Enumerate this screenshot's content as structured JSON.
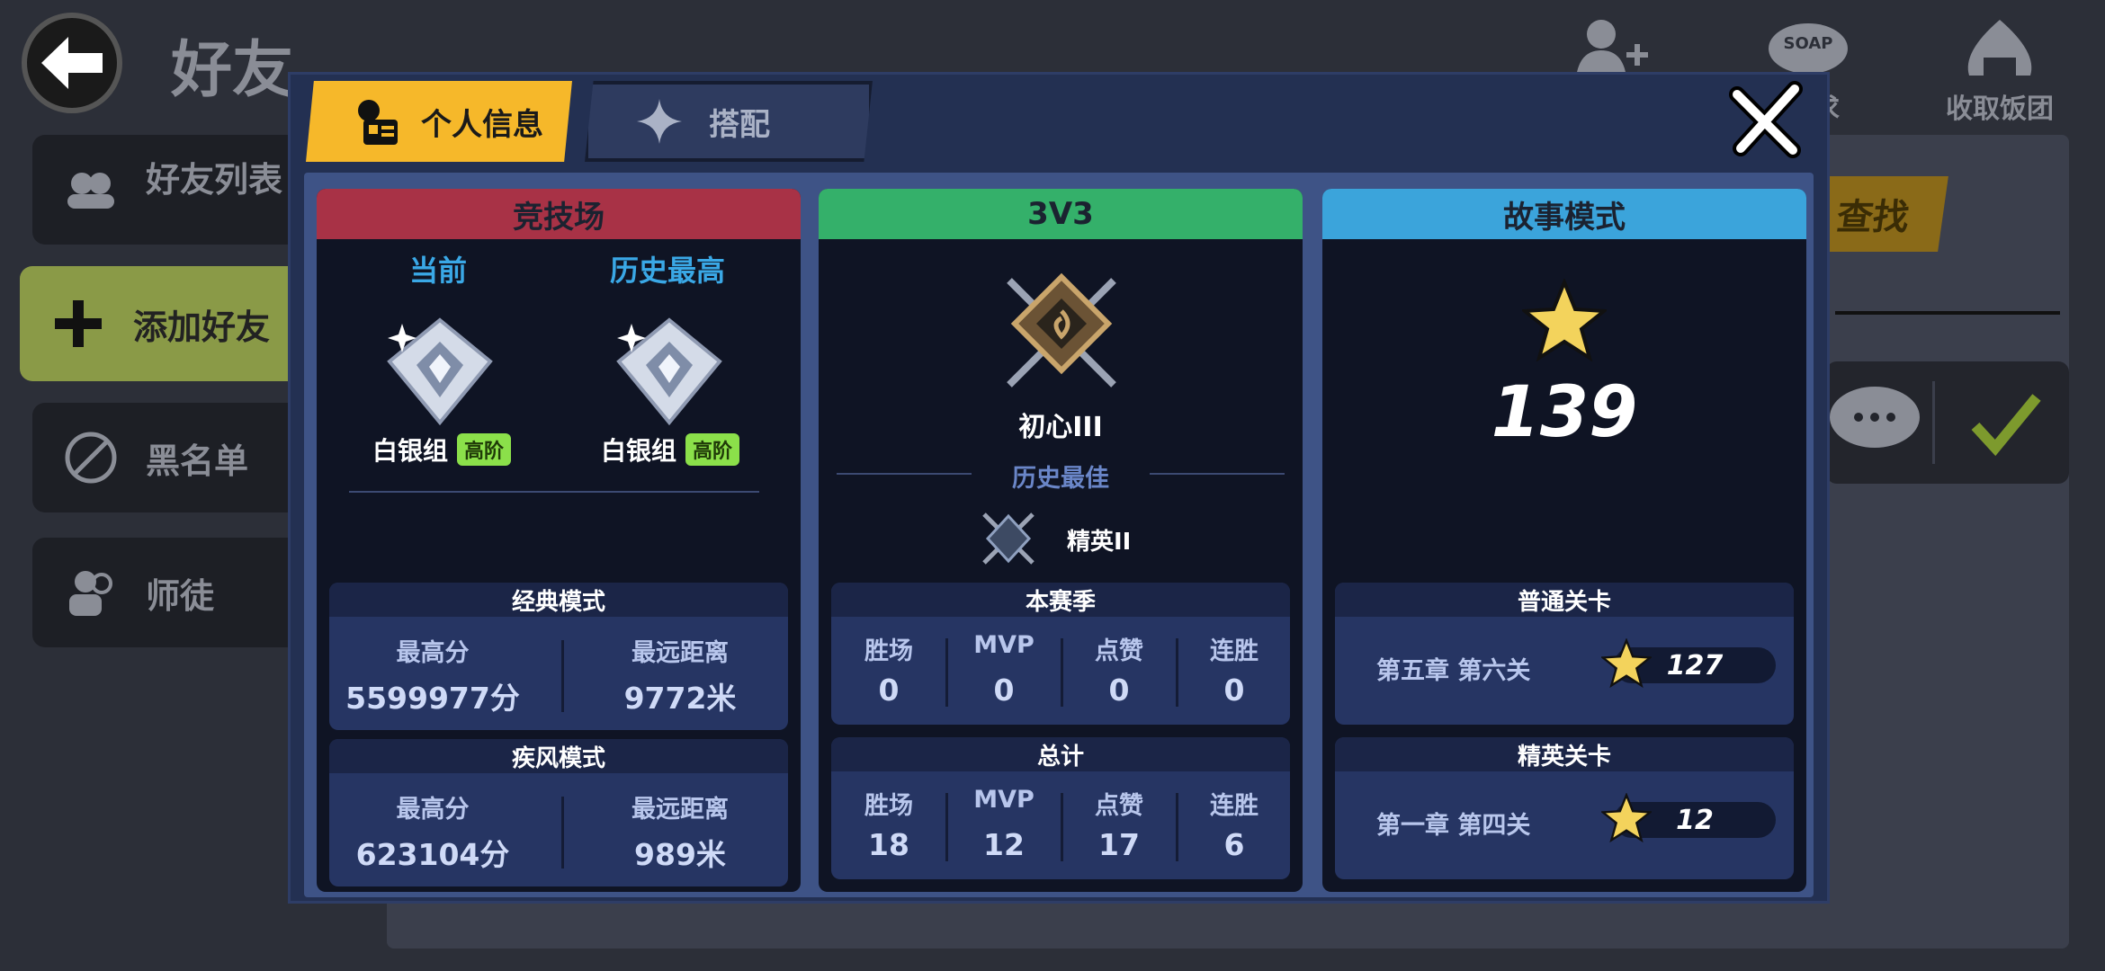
{
  "background": {
    "title": "好友",
    "top_actions": [
      {
        "label": "",
        "icon": "add-friend-icon"
      },
      {
        "label": "求",
        "icon": "soap-icon"
      },
      {
        "label": "收取饭团",
        "icon": "rice-ball-icon"
      }
    ],
    "sidebar": [
      {
        "label": "好友列表",
        "icon": "friends-icon"
      },
      {
        "label": "添加好友",
        "icon": "plus-icon"
      },
      {
        "label": "黑名单",
        "icon": "block-icon"
      },
      {
        "label": "师徒",
        "icon": "mentor-icon"
      }
    ],
    "search_label": "查找",
    "soap_text": "SOAP"
  },
  "modal": {
    "tabs": [
      {
        "label": "个人信息",
        "icon": "profile-card-icon"
      },
      {
        "label": "搭配",
        "icon": "sparkle-icon"
      }
    ],
    "arena": {
      "title": "竞技场",
      "current_label": "当前",
      "best_label": "历史最高",
      "current_rank": "白银组",
      "current_tier": "高阶",
      "best_rank": "白银组",
      "best_tier": "高阶",
      "classic": {
        "title": "经典模式",
        "score_label": "最高分",
        "score": "5599977分",
        "dist_label": "最远距离",
        "dist": "9772米"
      },
      "gale": {
        "title": "疾风模式",
        "score_label": "最高分",
        "score": "623104分",
        "dist_label": "最远距离",
        "dist": "989米"
      }
    },
    "v3": {
      "title": "3V3",
      "rank": "初心III",
      "best_label": "历史最佳",
      "best_rank": "精英II",
      "season": {
        "title": "本赛季",
        "labels": [
          "胜场",
          "MVP",
          "点赞",
          "连胜"
        ],
        "values": [
          "0",
          "0",
          "0",
          "0"
        ]
      },
      "total": {
        "title": "总计",
        "labels": [
          "胜场",
          "MVP",
          "点赞",
          "连胜"
        ],
        "values": [
          "18",
          "12",
          "17",
          "6"
        ]
      }
    },
    "story": {
      "title": "故事模式",
      "total_stars": "139",
      "normal": {
        "title": "普通关卡",
        "stage": "第五章 第六关",
        "stars": "127"
      },
      "elite": {
        "title": "精英关卡",
        "stage": "第一章 第四关",
        "stars": "12"
      }
    }
  },
  "colors": {
    "arena_header": "#a83246",
    "v3_header": "#34b06a",
    "story_header": "#3ba4db",
    "tab_active": "#f6b82a",
    "label_blue": "#3aa8e6"
  }
}
